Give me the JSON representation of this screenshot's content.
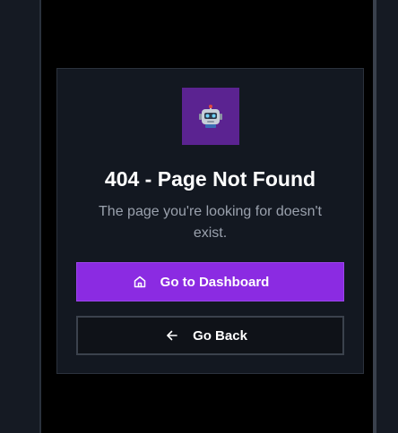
{
  "error": {
    "title": "404 - Page Not Found",
    "message": "The page you're looking for doesn't exist."
  },
  "actions": {
    "dashboard_label": "Go to Dashboard",
    "dashboard_icon": "home-icon",
    "back_label": "Go Back",
    "back_icon": "arrow-left-icon"
  },
  "branding": {
    "logo_icon": "robot-icon",
    "logo_bg": "#5b2391"
  },
  "colors": {
    "background": "#000000",
    "card": "#131821",
    "primary": "#8b2be2",
    "text": "#ffffff",
    "muted_text": "#9aa1ad"
  }
}
